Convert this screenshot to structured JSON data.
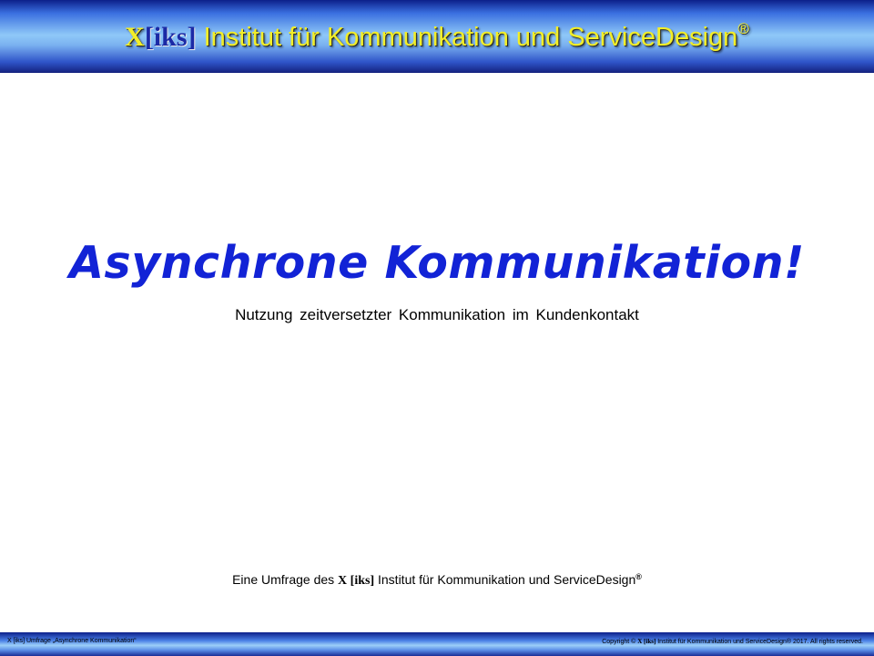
{
  "header": {
    "brand_x": "X",
    "brand_iks": "[iks]",
    "title": " Institut für Kommunikation und ServiceDesign",
    "reg_mark": "®"
  },
  "main": {
    "title": "Asynchrone Kommunikation!",
    "subtitle": "Nutzung zeitversetzter Kommunikation im Kundenkontakt"
  },
  "survey": {
    "prefix": "Eine Umfrage des ",
    "brand": "X [iks]",
    "suffix": " Institut für Kommunikation und ServiceDesign",
    "reg_mark": "®"
  },
  "footer": {
    "left_text": "X [iks] Umfrage „Asynchrone Kommunikation“",
    "right_prefix": "Copyright © ",
    "right_brand": "X [iks]",
    "right_suffix": " Institut für Kommunikation und ServiceDesign® 2017. All rights reserved."
  },
  "colors": {
    "header_text": "#f2ee28",
    "brand_iks": "#1b2aa6",
    "title": "#1223d6",
    "header_bar": "#3a6fe0"
  }
}
